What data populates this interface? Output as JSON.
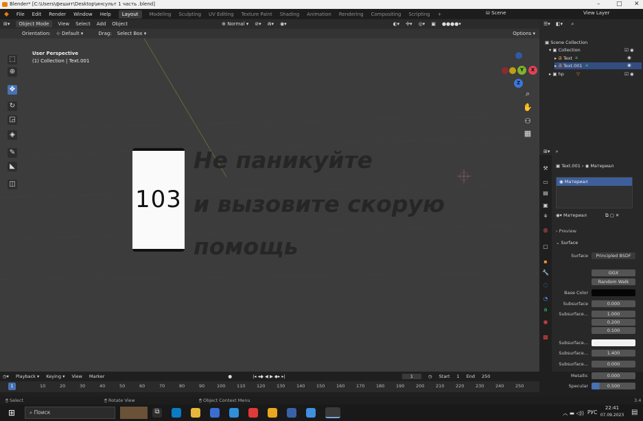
{
  "window": {
    "title": "Blender* [C:\\Users\\фешит\\Desktop\\инсульт 1 часть .blend]",
    "minimize": "–",
    "maximize": "□",
    "close": "✕"
  },
  "menu": [
    "File",
    "Edit",
    "Render",
    "Window",
    "Help"
  ],
  "workspaces": [
    "Layout",
    "Modeling",
    "Sculpting",
    "UV Editing",
    "Texture Paint",
    "Shading",
    "Animation",
    "Rendering",
    "Compositing",
    "Scripting",
    "+"
  ],
  "scene": {
    "label": "Scene",
    "view_layer": "View Layer"
  },
  "viewport": {
    "mode": "Object Mode",
    "view": "View",
    "select": "Select",
    "add": "Add",
    "object": "Object",
    "shading": "Normal",
    "orientation_label": "Orientation:",
    "orientation": "Default",
    "drag_label": "Drag:",
    "drag": "Select Box",
    "options": "Options",
    "persp_title": "User Perspective",
    "persp_sub": "(1) Collection | Text.001",
    "axis_x": "X",
    "axis_y": "Y",
    "axis_z": "Z",
    "phone_text": "103",
    "text_line1": "Не паникуйте",
    "text_line2": "и вызовите скорую",
    "text_line3": "помощь"
  },
  "outliner": {
    "root": "Scene Collection",
    "items": [
      {
        "name": "Collection",
        "icon": "collection-icon"
      },
      {
        "name": "Text",
        "icon": "text-icon"
      },
      {
        "name": "Text.001",
        "icon": "text-icon"
      },
      {
        "name": "hp",
        "icon": "collection-icon"
      }
    ]
  },
  "properties": {
    "breadcrumb_obj": "Text.001",
    "breadcrumb_mat": "Материал",
    "slot": "Материал",
    "material_name": "Материал",
    "preview": "Preview",
    "surface_section": "Surface",
    "surface_label": "Surface",
    "surface_value": "Principled BSDF",
    "distribution": "GGX",
    "subsurface_method": "Random Walk",
    "rows": [
      {
        "label": "Base Color",
        "value": ""
      },
      {
        "label": "Subsurface",
        "value": "0.000"
      },
      {
        "label": "Subsurface...",
        "value": "1.000"
      },
      {
        "label": "",
        "value": "0.200"
      },
      {
        "label": "",
        "value": "0.100"
      },
      {
        "label": "Subsurface...",
        "value": ""
      },
      {
        "label": "Subsurface...",
        "value": "1.400"
      },
      {
        "label": "Subsurface...",
        "value": "0.000"
      },
      {
        "label": "Metallic",
        "value": "0.000"
      },
      {
        "label": "Specular",
        "value": "0.500"
      }
    ]
  },
  "timeline": {
    "playback": "Playback",
    "keying": "Keying",
    "view": "View",
    "marker": "Marker",
    "current_frame": "1",
    "start_label": "Start",
    "start": "1",
    "end_label": "End",
    "end": "250",
    "ruler": [
      "1",
      "10",
      "20",
      "30",
      "40",
      "50",
      "60",
      "70",
      "80",
      "90",
      "100",
      "110",
      "120",
      "130",
      "140",
      "150",
      "160",
      "170",
      "180",
      "190",
      "200",
      "210",
      "220",
      "230",
      "240",
      "250"
    ]
  },
  "status": {
    "select": "Select",
    "rotate": "Rotate View",
    "context": "Object Context Menu",
    "version": "3.4"
  },
  "taskbar": {
    "search_placeholder": "Поиск",
    "lang": "РУС",
    "time": "22:41",
    "date": "07.09.2023"
  }
}
